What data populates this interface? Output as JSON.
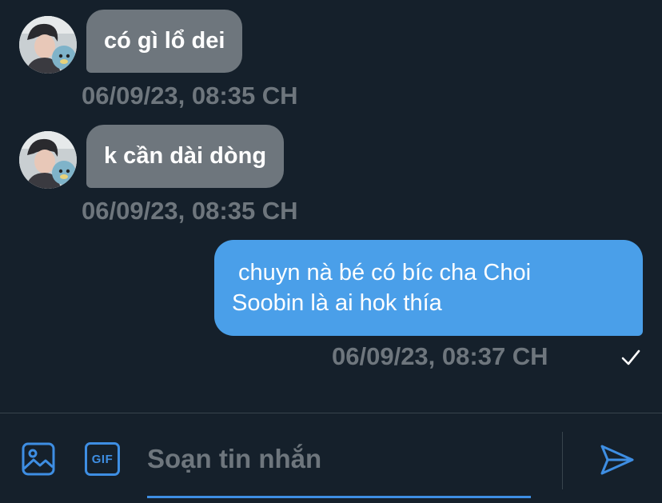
{
  "conversation": {
    "messages": [
      {
        "direction": "incoming",
        "text": "có gì lổ dei",
        "timestamp": "06/09/23, 08:35 CH"
      },
      {
        "direction": "incoming",
        "text": "k cần dài dòng",
        "timestamp": "06/09/23, 08:35 CH"
      },
      {
        "direction": "outgoing",
        "text_line1": " chuyn nà bé có bíc cha Choi",
        "text_line2": "Soobin là ai hok thía",
        "timestamp": "06/09/23, 08:37 CH",
        "status_icon": "check-icon"
      }
    ]
  },
  "composer": {
    "placeholder": "Soạn tin nhắn",
    "gif_label": "GIF",
    "icons": [
      "image-icon",
      "gif-icon",
      "send-icon"
    ]
  },
  "colors": {
    "background": "#15202b",
    "incoming_bubble": "#6e767d",
    "outgoing_bubble": "#4a9fe9",
    "accent": "#3e8ee3",
    "muted_text": "#6e767d"
  }
}
